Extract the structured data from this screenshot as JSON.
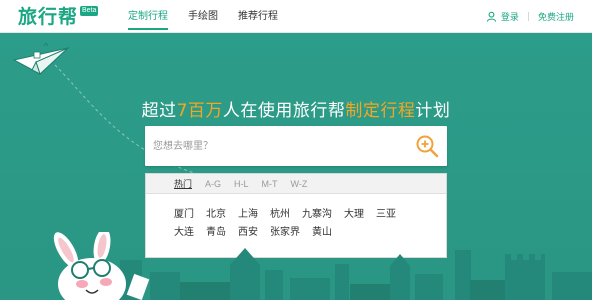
{
  "header": {
    "logo_text": "旅行帮",
    "beta_badge": "Beta",
    "nav": [
      {
        "label": "定制行程",
        "active": true
      },
      {
        "label": "手绘图",
        "active": false
      },
      {
        "label": "推荐行程",
        "active": false
      }
    ],
    "login_label": "登录",
    "separator": "|",
    "register_label": "免费注册"
  },
  "hero": {
    "headline_pre": "超过",
    "headline_number": "7百万",
    "headline_mid": "人在使用旅行帮",
    "headline_highlight": "制定行程",
    "headline_post": "计划"
  },
  "search": {
    "placeholder": "您想去哪里？",
    "value": "",
    "button_icon": "search-plus-icon"
  },
  "panel": {
    "tabs": [
      {
        "label": "热门",
        "active": true
      },
      {
        "label": "A-G",
        "active": false
      },
      {
        "label": "H-L",
        "active": false
      },
      {
        "label": "M-T",
        "active": false
      },
      {
        "label": "W-Z",
        "active": false
      }
    ],
    "cities": [
      [
        "厦门",
        "北京",
        "上海",
        "杭州",
        "九寨沟",
        "大理",
        "三亚"
      ],
      [
        "大连",
        "青岛",
        "西安",
        "张家界",
        "黄山"
      ]
    ]
  },
  "colors": {
    "brand": "#1ba784",
    "hero_bg": "#2a9a86",
    "highlight": "#f5a623"
  }
}
